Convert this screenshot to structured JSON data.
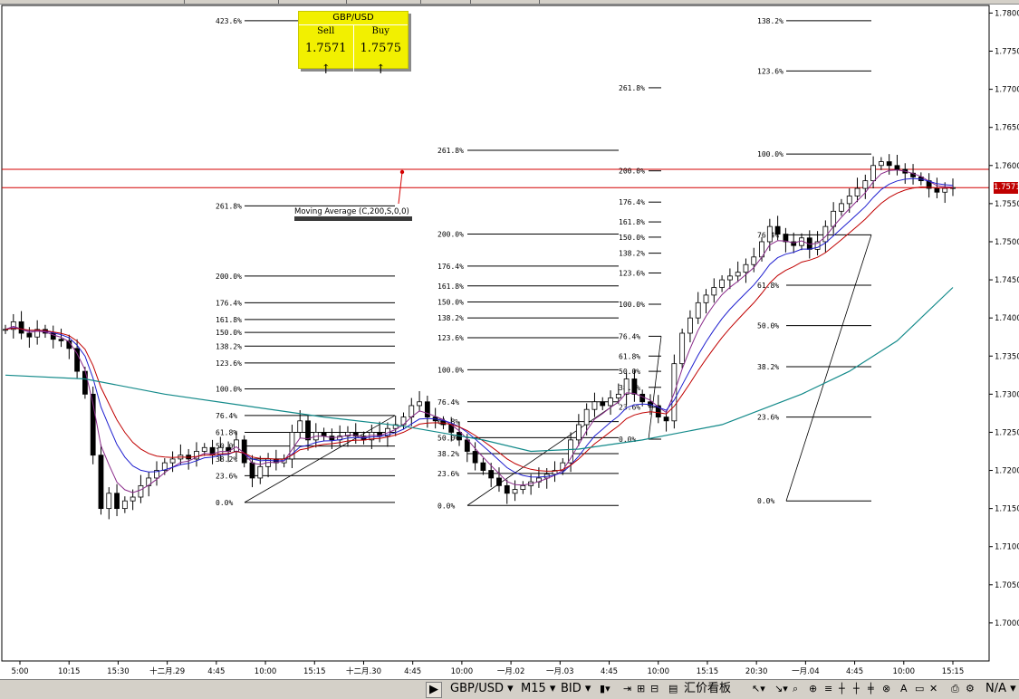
{
  "chart_data": {
    "type": "candlestick",
    "symbol": "GBP/USD",
    "timeframe": "M15",
    "price_side": "BID",
    "ylim": [
      1.695,
      1.781
    ],
    "y_ticks": [
      "1.7800",
      "1.7750",
      "1.7700",
      "1.7650",
      "1.7600",
      "1.7550",
      "1.7500",
      "1.7450",
      "1.7400",
      "1.7350",
      "1.7300",
      "1.7250",
      "1.7200",
      "1.7150",
      "1.7100",
      "1.7050",
      "1.7000"
    ],
    "x_ticks": [
      "5:00",
      "10:15",
      "15:30",
      "十二月.29",
      "4:45",
      "10:00",
      "15:15",
      "十二月.30",
      "4:45",
      "10:00",
      "一月.02",
      "一月.03",
      "4:45",
      "10:00",
      "15:15",
      "20:30",
      "一月.04",
      "4:45",
      "10:00",
      "15:15"
    ],
    "current_price": "1.7571",
    "indicator_label": "Moving Average (C,200,S,0,0)",
    "horizontal_lines": [
      1.7595,
      1.7571
    ],
    "close_path": [
      [
        0,
        1.7385
      ],
      [
        1,
        1.7395
      ],
      [
        2,
        1.738
      ],
      [
        3,
        1.7375
      ],
      [
        4,
        1.7385
      ],
      [
        5,
        1.738
      ],
      [
        6,
        1.7372
      ],
      [
        7,
        1.737
      ],
      [
        8,
        1.736
      ],
      [
        9,
        1.733
      ],
      [
        10,
        1.73
      ],
      [
        11,
        1.722
      ],
      [
        12,
        1.715
      ],
      [
        13,
        1.717
      ],
      [
        14,
        1.715
      ],
      [
        15,
        1.716
      ],
      [
        16,
        1.7165
      ],
      [
        17,
        1.718
      ],
      [
        18,
        1.719
      ],
      [
        19,
        1.72
      ],
      [
        20,
        1.721
      ],
      [
        21,
        1.7215
      ],
      [
        22,
        1.722
      ],
      [
        23,
        1.7215
      ],
      [
        24,
        1.7225
      ],
      [
        25,
        1.723
      ],
      [
        26,
        1.722
      ],
      [
        27,
        1.723
      ],
      [
        28,
        1.7225
      ],
      [
        29,
        1.724
      ],
      [
        30,
        1.721
      ],
      [
        31,
        1.719
      ],
      [
        32,
        1.7205
      ],
      [
        33,
        1.7215
      ],
      [
        34,
        1.721
      ],
      [
        35,
        1.7215
      ],
      [
        36,
        1.725
      ],
      [
        37,
        1.7265
      ],
      [
        38,
        1.724
      ],
      [
        39,
        1.725
      ],
      [
        40,
        1.7245
      ],
      [
        41,
        1.724
      ],
      [
        42,
        1.7245
      ],
      [
        43,
        1.725
      ],
      [
        44,
        1.7245
      ],
      [
        45,
        1.724
      ],
      [
        46,
        1.725
      ],
      [
        47,
        1.7245
      ],
      [
        48,
        1.7255
      ],
      [
        49,
        1.726
      ],
      [
        50,
        1.727
      ],
      [
        51,
        1.7285
      ],
      [
        52,
        1.729
      ],
      [
        53,
        1.727
      ],
      [
        54,
        1.7265
      ],
      [
        55,
        1.726
      ],
      [
        56,
        1.725
      ],
      [
        57,
        1.724
      ],
      [
        58,
        1.7225
      ],
      [
        59,
        1.721
      ],
      [
        60,
        1.72
      ],
      [
        61,
        1.719
      ],
      [
        62,
        1.718
      ],
      [
        63,
        1.717
      ],
      [
        64,
        1.7175
      ],
      [
        65,
        1.718
      ],
      [
        66,
        1.7185
      ],
      [
        67,
        1.719
      ],
      [
        68,
        1.7195
      ],
      [
        69,
        1.72
      ],
      [
        70,
        1.721
      ],
      [
        71,
        1.724
      ],
      [
        72,
        1.726
      ],
      [
        73,
        1.728
      ],
      [
        74,
        1.729
      ],
      [
        75,
        1.7285
      ],
      [
        76,
        1.7295
      ],
      [
        77,
        1.73
      ],
      [
        78,
        1.732
      ],
      [
        79,
        1.73
      ],
      [
        80,
        1.729
      ],
      [
        81,
        1.7285
      ],
      [
        82,
        1.727
      ],
      [
        83,
        1.7265
      ],
      [
        84,
        1.734
      ],
      [
        85,
        1.738
      ],
      [
        86,
        1.74
      ],
      [
        87,
        1.742
      ],
      [
        88,
        1.743
      ],
      [
        89,
        1.744
      ],
      [
        90,
        1.745
      ],
      [
        91,
        1.7455
      ],
      [
        92,
        1.746
      ],
      [
        93,
        1.747
      ],
      [
        94,
        1.748
      ],
      [
        95,
        1.75
      ],
      [
        96,
        1.752
      ],
      [
        97,
        1.751
      ],
      [
        98,
        1.75
      ],
      [
        99,
        1.7495
      ],
      [
        100,
        1.7505
      ],
      [
        101,
        1.749
      ],
      [
        102,
        1.75
      ],
      [
        103,
        1.752
      ],
      [
        104,
        1.754
      ],
      [
        105,
        1.755
      ],
      [
        106,
        1.756
      ],
      [
        107,
        1.757
      ],
      [
        108,
        1.758
      ],
      [
        109,
        1.76
      ],
      [
        110,
        1.7605
      ],
      [
        111,
        1.76
      ],
      [
        112,
        1.7595
      ],
      [
        113,
        1.759
      ],
      [
        114,
        1.7585
      ],
      [
        115,
        1.758
      ],
      [
        116,
        1.757
      ],
      [
        117,
        1.7565
      ],
      [
        118,
        1.757
      ],
      [
        119,
        1.7571
      ]
    ],
    "ma200_path": [
      [
        0,
        1.7325
      ],
      [
        10,
        1.732
      ],
      [
        20,
        1.73
      ],
      [
        30,
        1.7285
      ],
      [
        40,
        1.727
      ],
      [
        50,
        1.7258
      ],
      [
        60,
        1.724
      ],
      [
        66,
        1.7225
      ],
      [
        72,
        1.7228
      ],
      [
        80,
        1.724
      ],
      [
        90,
        1.726
      ],
      [
        100,
        1.73
      ],
      [
        106,
        1.733
      ],
      [
        112,
        1.737
      ],
      [
        119,
        1.744
      ]
    ],
    "fibonacci_sets": [
      {
        "labels": [
          "423.6%",
          "261.8%",
          "200.0%",
          "176.4%",
          "161.8%",
          "150.0%",
          "138.2%",
          "123.6%",
          "100.0%",
          "76.4%",
          "61.8%",
          "50.0%",
          "38.2%",
          "23.6%",
          "0.0%"
        ],
        "levels": [
          1.779,
          1.7547,
          1.7455,
          1.742,
          1.7398,
          1.7381,
          1.7363,
          1.7341,
          1.7307,
          1.7272,
          1.725,
          1.7232,
          1.7215,
          1.7193,
          1.7158
        ]
      },
      {
        "labels": [
          "261.8%",
          "200.0%",
          "176.4%",
          "161.8%",
          "150.0%",
          "138.2%",
          "123.6%",
          "100.0%",
          "76.4%",
          "61.8%",
          "50.0%",
          "38.2%",
          "23.6%",
          "0.0%"
        ],
        "levels": [
          1.762,
          1.751,
          1.7468,
          1.7442,
          1.7421,
          1.74,
          1.7374,
          1.7332,
          1.729,
          1.7264,
          1.7243,
          1.7222,
          1.7196,
          1.7154
        ]
      },
      {
        "labels": [
          "261.8%",
          "200.0%",
          "176.4%",
          "161.8%",
          "150.0%",
          "138.2%",
          "123.6%",
          "100.0%",
          "76.4%",
          "61.8%",
          "50.0%",
          "38.2%",
          "23.6%",
          "0.0%"
        ],
        "levels": [
          1.7702,
          1.7593,
          1.7552,
          1.7526,
          1.7506,
          1.7485,
          1.7459,
          1.7418,
          1.7376,
          1.735,
          1.733,
          1.7309,
          1.7283,
          1.7241
        ]
      },
      {
        "labels": [
          "138.2%",
          "123.6%",
          "100.0%",
          "76.4%",
          "61.8%",
          "50.0%",
          "38.2%",
          "23.6%",
          "0.0%"
        ],
        "levels": [
          1.779,
          1.7724,
          1.7615,
          1.7509,
          1.7443,
          1.739,
          1.7336,
          1.727,
          1.716
        ]
      }
    ]
  },
  "quote_panel": {
    "symbol": "GBP/USD",
    "sell_label": "Sell",
    "buy_label": "Buy",
    "sell_price": "1.7571",
    "buy_price": "1.7575",
    "sell_arrow": "↑",
    "buy_arrow": "↑"
  },
  "toolbar": {
    "symbol": "GBP/USD",
    "timeframe": "M15",
    "price_type": "BID",
    "board_label": "汇价看板",
    "na_label": "N/A",
    "play_glyph": "▶",
    "dropdown_glyph": "▾"
  },
  "colors": {
    "ma_red": "#c00000",
    "ma_blue": "#1f1fcf",
    "ma_purple": "#8a2b8a",
    "ma200_teal": "#138a8a",
    "hline_red": "#d40000",
    "price_tag": "#c00000"
  }
}
